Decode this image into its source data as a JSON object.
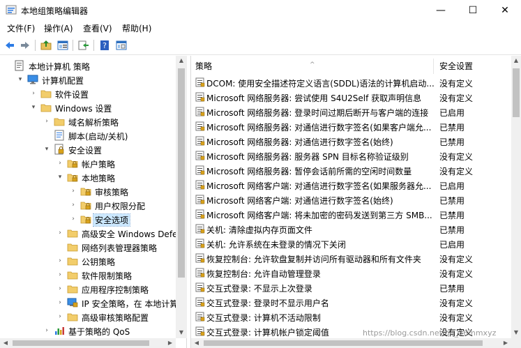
{
  "window": {
    "title": "本地组策略编辑器",
    "controls": {
      "minimize": "—",
      "maximize": "☐",
      "close": "✕"
    }
  },
  "menu": {
    "items": [
      "文件(F)",
      "操作(A)",
      "查看(V)",
      "帮助(H)"
    ]
  },
  "toolbar": {
    "buttons": [
      "back-arrow-icon",
      "forward-arrow-icon",
      "up-folder-icon",
      "show-hide-tree-icon",
      "export-list-icon",
      "help-icon",
      "properties-icon"
    ]
  },
  "tree": {
    "items": [
      {
        "label": "本地计算机 策略",
        "level": 0,
        "expander": "",
        "icon": "policy-root-icon"
      },
      {
        "label": "计算机配置",
        "level": 1,
        "expander": "▾",
        "icon": "computer-config-icon"
      },
      {
        "label": "软件设置",
        "level": 2,
        "expander": "›",
        "icon": "folder-icon"
      },
      {
        "label": "Windows 设置",
        "level": 2,
        "expander": "▾",
        "icon": "folder-icon"
      },
      {
        "label": "域名解析策略",
        "level": 3,
        "expander": "›",
        "icon": "folder-icon"
      },
      {
        "label": "脚本(启动/关机)",
        "level": 3,
        "expander": "",
        "icon": "script-icon"
      },
      {
        "label": "安全设置",
        "level": 3,
        "expander": "▾",
        "icon": "security-settings-icon"
      },
      {
        "label": "帐户策略",
        "level": 4,
        "expander": "›",
        "icon": "lock-folder-icon"
      },
      {
        "label": "本地策略",
        "level": 4,
        "expander": "▾",
        "icon": "lock-folder-icon"
      },
      {
        "label": "审核策略",
        "level": 5,
        "expander": "›",
        "icon": "lock-folder-icon"
      },
      {
        "label": "用户权限分配",
        "level": 5,
        "expander": "›",
        "icon": "lock-folder-icon"
      },
      {
        "label": "安全选项",
        "level": 5,
        "expander": "›",
        "icon": "lock-folder-icon",
        "selected": true
      },
      {
        "label": "高级安全 Windows Defender",
        "level": 4,
        "expander": "›",
        "icon": "folder-icon"
      },
      {
        "label": "网络列表管理器策略",
        "level": 4,
        "expander": "",
        "icon": "folder-icon"
      },
      {
        "label": "公钥策略",
        "level": 4,
        "expander": "›",
        "icon": "folder-icon"
      },
      {
        "label": "软件限制策略",
        "level": 4,
        "expander": "›",
        "icon": "folder-icon"
      },
      {
        "label": "应用程序控制策略",
        "level": 4,
        "expander": "›",
        "icon": "folder-icon"
      },
      {
        "label": "IP 安全策略，在 本地计算机",
        "level": 4,
        "expander": "›",
        "icon": "ip-security-icon"
      },
      {
        "label": "高级审核策略配置",
        "level": 4,
        "expander": "›",
        "icon": "folder-icon"
      },
      {
        "label": "基于策略的 QoS",
        "level": 3,
        "expander": "›",
        "icon": "qos-chart-icon"
      }
    ]
  },
  "list": {
    "columns": {
      "policy": "策略",
      "setting": "安全设置"
    },
    "rows": [
      {
        "name": "DCOM: 使用安全描述符定义语言(SDDL)语法的计算机启动...",
        "value": "没有定义"
      },
      {
        "name": "Microsoft 网络服务器: 尝试使用 S4U2Self 获取声明信息",
        "value": "没有定义"
      },
      {
        "name": "Microsoft 网络服务器: 登录时间过期后断开与客户端的连接",
        "value": "已启用"
      },
      {
        "name": "Microsoft 网络服务器: 对通信进行数字签名(如果客户端允...",
        "value": "已禁用"
      },
      {
        "name": "Microsoft 网络服务器: 对通信进行数字签名(始终)",
        "value": "已禁用"
      },
      {
        "name": "Microsoft 网络服务器: 服务器 SPN 目标名称验证级别",
        "value": "没有定义"
      },
      {
        "name": "Microsoft 网络服务器: 暂停会话前所需的空闲时间数量",
        "value": "没有定义"
      },
      {
        "name": "Microsoft 网络客户端: 对通信进行数字签名(如果服务器允...",
        "value": "已启用"
      },
      {
        "name": "Microsoft 网络客户端: 对通信进行数字签名(始终)",
        "value": "已禁用"
      },
      {
        "name": "Microsoft 网络客户端: 将未加密的密码发送到第三方 SMB...",
        "value": "已禁用"
      },
      {
        "name": "关机: 清除虚拟内存页面文件",
        "value": "已禁用"
      },
      {
        "name": "关机: 允许系统在未登录的情况下关闭",
        "value": "已启用"
      },
      {
        "name": "恢复控制台: 允许软盘复制并访问所有驱动器和所有文件夹",
        "value": "没有定义"
      },
      {
        "name": "恢复控制台: 允许自动管理登录",
        "value": "没有定义"
      },
      {
        "name": "交互式登录: 不显示上次登录",
        "value": "已禁用"
      },
      {
        "name": "交互式登录: 登录时不显示用户名",
        "value": "没有定义"
      },
      {
        "name": "交互式登录: 计算机不活动限制",
        "value": "没有定义"
      },
      {
        "name": "交互式登录: 计算机帐户锁定阈值",
        "value": "没有定义"
      }
    ]
  },
  "watermark": "https://blog.csdn.net/qq_36mmxyz",
  "colors": {
    "selection": "#cce8ff",
    "folder": "#e8c15a",
    "accent": "#1f6fd1"
  }
}
